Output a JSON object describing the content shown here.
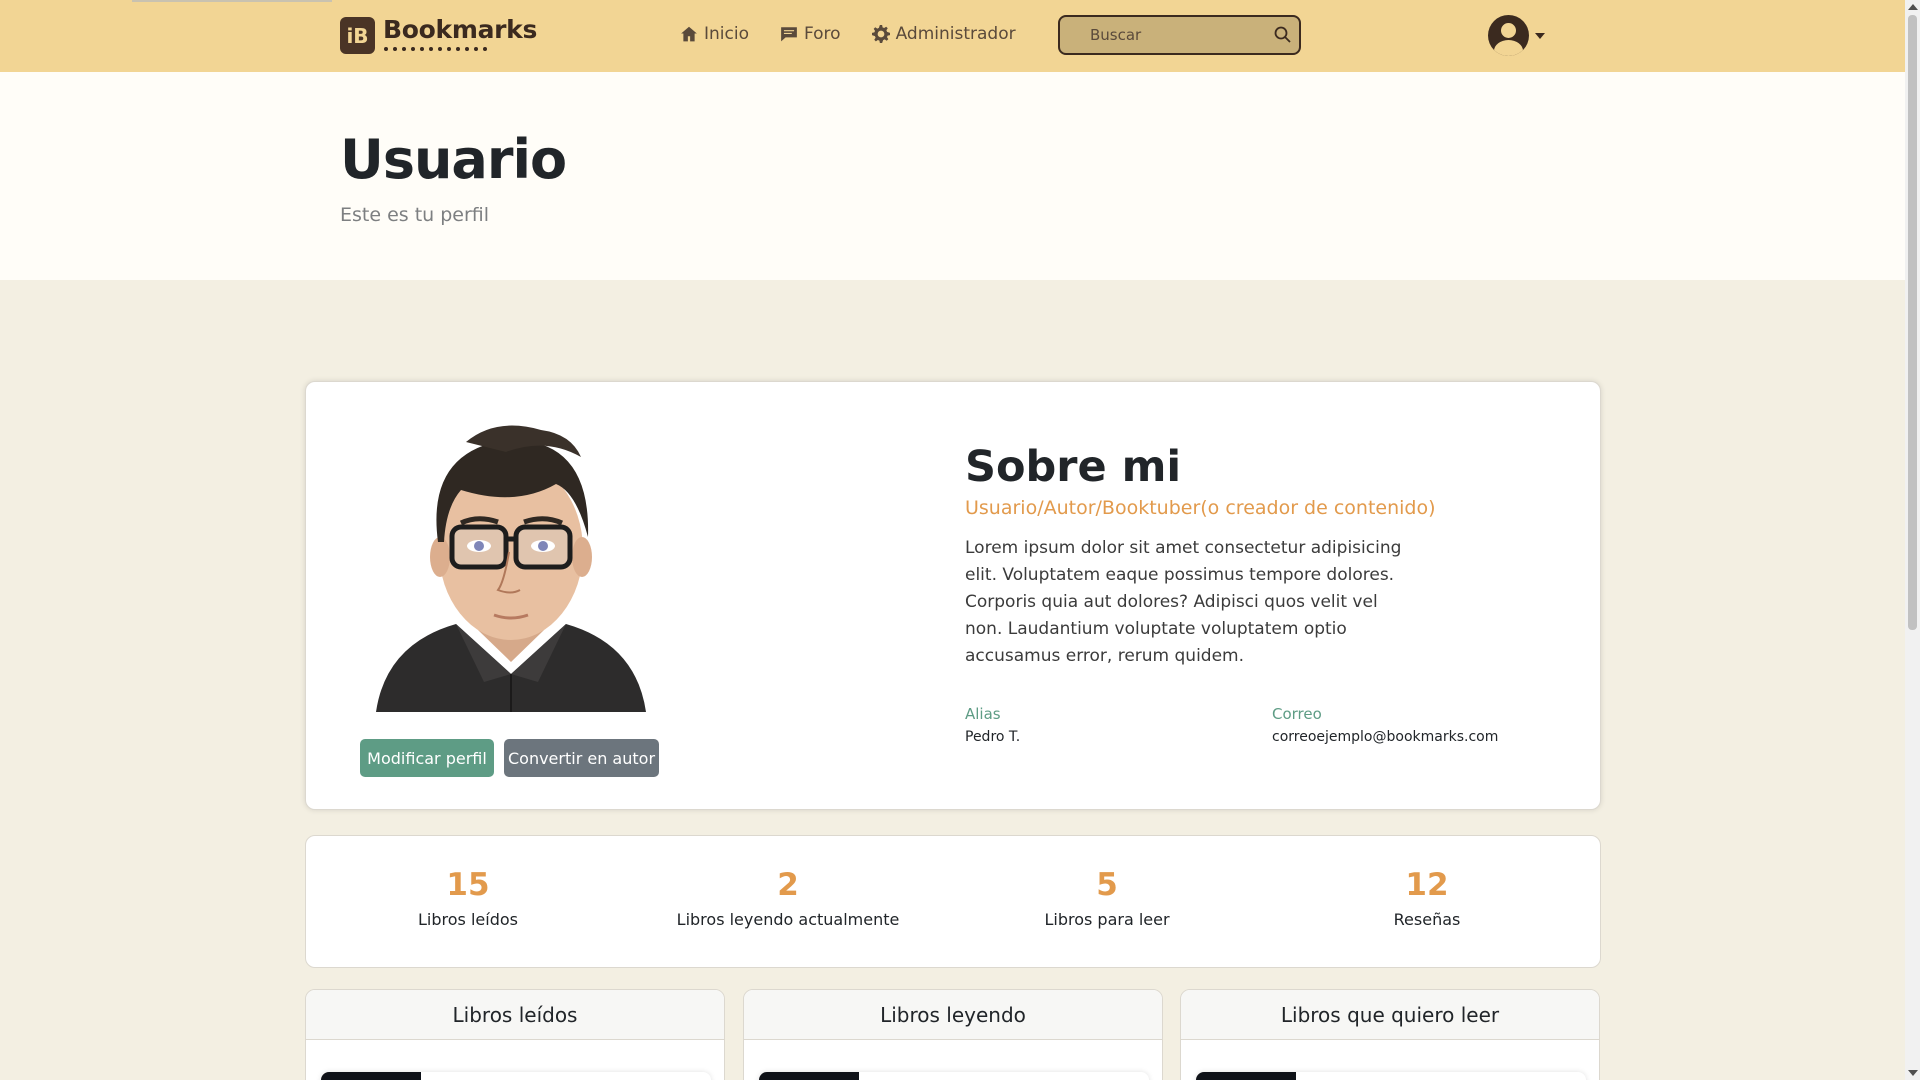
{
  "navbar": {
    "brand": "Bookmarks",
    "logo_letter": "iB",
    "links": [
      {
        "label": "Inicio",
        "icon": "home-icon"
      },
      {
        "label": "Foro",
        "icon": "chat-icon"
      },
      {
        "label": "Administrador",
        "icon": "gear-icon"
      }
    ],
    "search_placeholder": "Buscar",
    "bg_color": "#f2d594"
  },
  "header": {
    "title": "Usuario",
    "subtitle": "Este es tu perfil"
  },
  "profile": {
    "about_title": "Sobre mi",
    "role": "Usuario/Autor/Booktuber(o creador de contenido)",
    "bio": "Lorem ipsum dolor sit amet consectetur adipisicing elit. Voluptatem eaque possimus tempore dolores. Corporis quia aut dolores? Adipisci quos velit vel non. Laudantium voluptate voluptatem optio accusamus error, rerum quidem.",
    "alias_label": "Alias",
    "alias_value": "Pedro T.",
    "email_label": "Correo",
    "email_value": "correoejemplo@bookmarks.com",
    "edit_button": "Modificar perfil",
    "author_button": "Convertir en autor"
  },
  "stats": [
    {
      "value": "15",
      "label": "Libros leídos"
    },
    {
      "value": "2",
      "label": "Libros leyendo actualmente"
    },
    {
      "value": "5",
      "label": "Libros para leer"
    },
    {
      "value": "12",
      "label": "Reseñas"
    }
  ],
  "lists": [
    {
      "title": "Libros leídos"
    },
    {
      "title": "Libros leyendo"
    },
    {
      "title": "Libros que quiero leer"
    }
  ],
  "colors": {
    "accent": "#e29a4c",
    "green": "#5e9c85",
    "gray_button": "#6c757d",
    "page_bg": "#f3efe2"
  }
}
